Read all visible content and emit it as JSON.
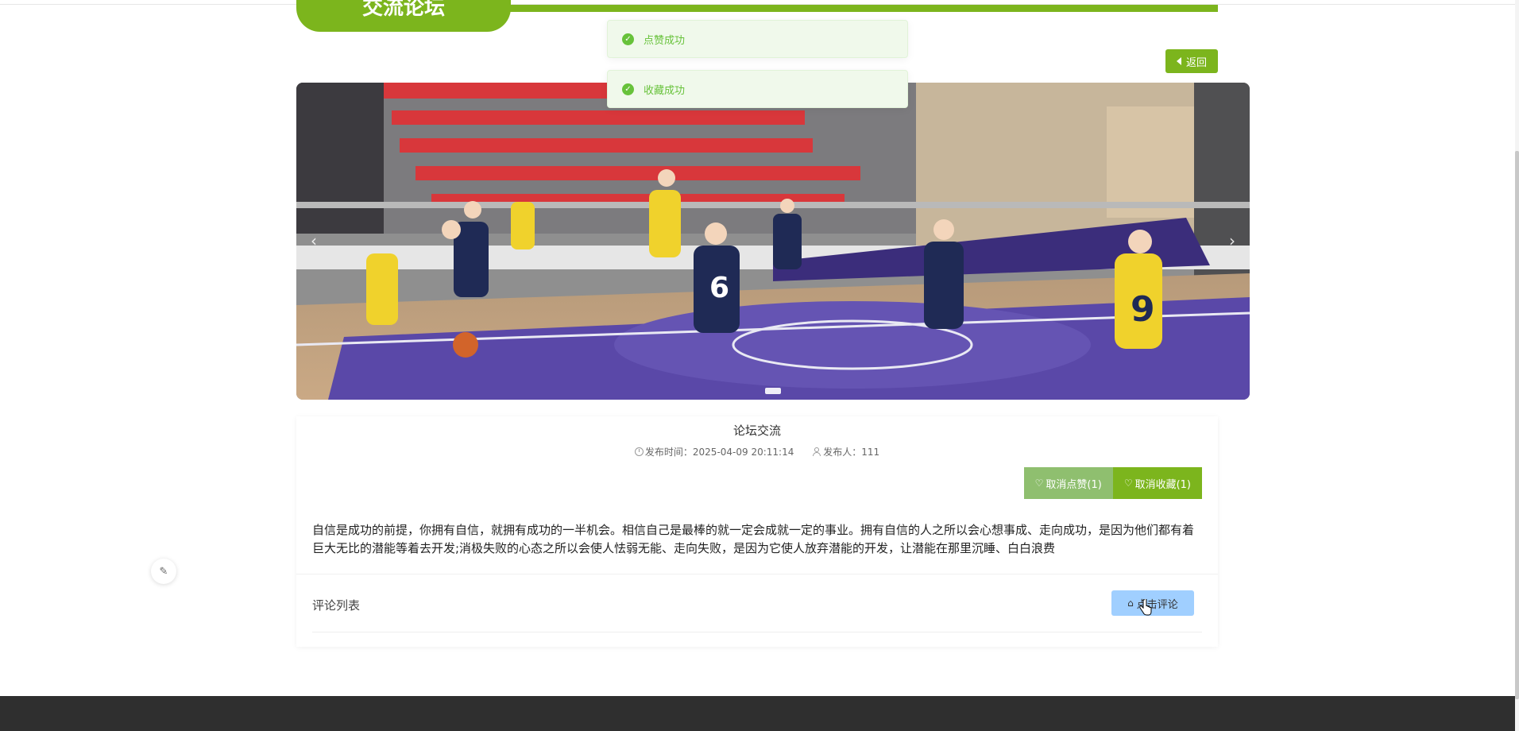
{
  "header": {
    "title": "交流论坛"
  },
  "toasts": [
    {
      "text": "点赞成功"
    },
    {
      "text": "收藏成功"
    }
  ],
  "nav": {
    "back_label": "返回"
  },
  "post": {
    "title": "论坛交流",
    "publish_time_label": "发布时间：",
    "publish_time": "2025-04-09 20:11:14",
    "author_label": "发布人：",
    "author": "111",
    "unlike_label": "取消点赞(1)",
    "unfavorite_label": "取消收藏(1)",
    "body": "自信是成功的前提，你拥有自信，就拥有成功的一半机会。相信自己是最棒的就一定会成就一定的事业。拥有自信的人之所以会心想事成、走向成功，是因为他们都有着巨大无比的潜能等着去开发;消极失败的心态之所以会使人怯弱无能、走向失败，是因为它使人放弃潜能的开发，让潜能在那里沉睡、白白浪费"
  },
  "comments": {
    "title": "评论列表",
    "add_label": "点击评论"
  },
  "colors": {
    "brand": "#7cb51d",
    "toast_bg": "#f0f9eb",
    "toast_text": "#67c23a",
    "comment_btn": "#a0cfff",
    "footer": "#2f2f2f"
  },
  "icons": {
    "toast": "check-circle-icon",
    "back": "caret-left-icon",
    "like": "heart-icon",
    "comment": "home-icon",
    "float": "edit-icon"
  }
}
